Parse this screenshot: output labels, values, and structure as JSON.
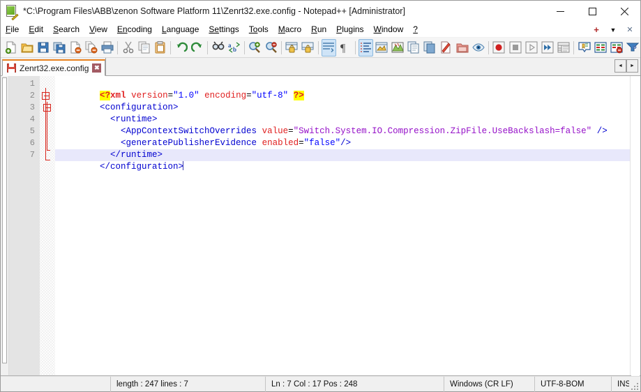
{
  "window": {
    "title": "*C:\\Program Files\\ABB\\zenon Software Platform 11\\Zenrt32.exe.config - Notepad++ [Administrator]",
    "app_icon": "notepad-plus-plus-icon",
    "minimize_label": "Minimize",
    "maximize_label": "Maximize",
    "close_label": "Close"
  },
  "menu": {
    "items": [
      {
        "label": "File",
        "pre": "F",
        "mid": "ile"
      },
      {
        "label": "Edit",
        "pre": "E",
        "mid": "dit"
      },
      {
        "label": "Search",
        "pre": "S",
        "mid": "earch"
      },
      {
        "label": "View",
        "pre": "V",
        "mid": "iew"
      },
      {
        "label": "Encoding",
        "pre": "En",
        "mid": "coding"
      },
      {
        "label": "Language",
        "pre": "L",
        "mid": "anguage"
      },
      {
        "label": "Settings",
        "pre": "Se",
        "mid": "ttings"
      },
      {
        "label": "Tools",
        "pre": "To",
        "mid": "ols"
      },
      {
        "label": "Macro",
        "pre": "M",
        "mid": "acro"
      },
      {
        "label": "Run",
        "pre": "R",
        "mid": "un"
      },
      {
        "label": "Plugins",
        "pre": "P",
        "mid": "lugins"
      },
      {
        "label": "Window",
        "pre": "W",
        "mid": "indow"
      },
      {
        "label": "?",
        "pre": "?",
        "mid": ""
      }
    ],
    "right_icons": [
      {
        "name": "new-tab-plus-icon",
        "glyph": "+",
        "color": "#b02a2a"
      },
      {
        "name": "tab-list-dropdown-icon",
        "glyph": "▼",
        "color": "#1a1a1a"
      },
      {
        "name": "close-document-icon",
        "glyph": "✕",
        "color": "#5a6e88"
      }
    ]
  },
  "toolbar": {
    "overflow_glyph": "»",
    "buttons": [
      {
        "name": "new-file-button",
        "tooltip": "New"
      },
      {
        "name": "open-file-button",
        "tooltip": "Open"
      },
      {
        "name": "save-button",
        "tooltip": "Save"
      },
      {
        "name": "save-all-button",
        "tooltip": "Save All"
      },
      {
        "name": "close-button",
        "tooltip": "Close"
      },
      {
        "name": "close-all-button",
        "tooltip": "Close All"
      },
      {
        "name": "print-button",
        "tooltip": "Print"
      },
      {
        "name": "cut-button",
        "tooltip": "Cut"
      },
      {
        "name": "copy-button",
        "tooltip": "Copy"
      },
      {
        "name": "paste-button",
        "tooltip": "Paste"
      },
      {
        "name": "undo-button",
        "tooltip": "Undo"
      },
      {
        "name": "redo-button",
        "tooltip": "Redo"
      },
      {
        "name": "find-button",
        "tooltip": "Find"
      },
      {
        "name": "replace-button",
        "tooltip": "Replace"
      },
      {
        "name": "zoom-in-button",
        "tooltip": "Zoom In"
      },
      {
        "name": "zoom-out-button",
        "tooltip": "Zoom Out"
      },
      {
        "name": "sync-vertical-scroll-button",
        "tooltip": "Synchronize Vertical Scrolling"
      },
      {
        "name": "sync-horizontal-scroll-button",
        "tooltip": "Synchronize Horizontal Scrolling"
      },
      {
        "name": "word-wrap-button",
        "tooltip": "Word wrap",
        "active": true
      },
      {
        "name": "show-all-characters-button",
        "tooltip": "Show All Characters"
      },
      {
        "name": "show-indent-guide-button",
        "tooltip": "Show Indent Guide",
        "active": true
      },
      {
        "name": "user-defined-dialog-button",
        "tooltip": "User Defined Dialogue"
      },
      {
        "name": "document-map-button",
        "tooltip": "Document Map"
      },
      {
        "name": "function-list-button",
        "tooltip": "Function List"
      },
      {
        "name": "document-list-button",
        "tooltip": "Document List"
      },
      {
        "name": "monitoring-button",
        "tooltip": "Monitoring"
      },
      {
        "name": "folder-as-workspace-button",
        "tooltip": "Folder as Workspace"
      },
      {
        "name": "preview-button",
        "tooltip": "Preview"
      },
      {
        "name": "record-macro-button",
        "tooltip": "Start Recording"
      },
      {
        "name": "stop-macro-button",
        "tooltip": "Stop Recording"
      },
      {
        "name": "play-macro-button",
        "tooltip": "Playback"
      },
      {
        "name": "run-macro-multiple-button",
        "tooltip": "Run a Macro Multiple Times"
      },
      {
        "name": "save-macro-button",
        "tooltip": "Save Current Recorded Macro"
      },
      {
        "name": "bookmark-button",
        "tooltip": "Toggle Bookmark"
      },
      {
        "name": "remove-duplicate-lines-button",
        "tooltip": "Remove Consecutive Duplicate Lines"
      },
      {
        "name": "remove-empty-lines-button",
        "tooltip": "Remove Empty Lines"
      },
      {
        "name": "sort-lines-button",
        "tooltip": "Sort Lines"
      }
    ]
  },
  "tabs": {
    "items": [
      {
        "label": "Zenrt32.exe.config",
        "modified": true,
        "active": true,
        "close_glyph": "✖"
      }
    ],
    "scroll_left_glyph": "◄",
    "scroll_right_glyph": "►"
  },
  "editor": {
    "line_numbers": [
      1,
      2,
      3,
      4,
      5,
      6,
      7
    ],
    "current_line": 7,
    "fold_markers": [
      {
        "line": 2,
        "type": "open-fold-box"
      },
      {
        "line": 3,
        "type": "open-fold-box"
      },
      {
        "line": 6,
        "type": "fold-branch-end"
      },
      {
        "line": 7,
        "type": "fold-tail-end"
      }
    ],
    "lines": [
      {
        "n": 1,
        "tokens": [
          {
            "t": "<?",
            "c": "tk-pi"
          },
          {
            "t": "xml",
            "c": "tk-pin"
          },
          {
            "t": " ",
            "c": "tk-eq"
          },
          {
            "t": "version",
            "c": "tk-attr"
          },
          {
            "t": "=",
            "c": "tk-eq"
          },
          {
            "t": "\"1.0\"",
            "c": "tk-val"
          },
          {
            "t": " ",
            "c": "tk-eq"
          },
          {
            "t": "encoding",
            "c": "tk-attr"
          },
          {
            "t": "=",
            "c": "tk-eq"
          },
          {
            "t": "\"utf-8\"",
            "c": "tk-val"
          },
          {
            "t": " ",
            "c": "tk-eq"
          },
          {
            "t": "?>",
            "c": "tk-pi"
          }
        ]
      },
      {
        "n": 2,
        "tokens": [
          {
            "t": "<configuration>",
            "c": "tk-tag"
          }
        ]
      },
      {
        "n": 3,
        "tokens": [
          {
            "t": "  <runtime>",
            "c": "tk-tag"
          }
        ]
      },
      {
        "n": 4,
        "tokens": [
          {
            "t": "    <AppContextSwitchOverrides ",
            "c": "tk-tag"
          },
          {
            "t": "value",
            "c": "tk-attr"
          },
          {
            "t": "=",
            "c": "tk-eq"
          },
          {
            "t": "\"Switch.System.IO.Compression.ZipFile.UseBackslash=false\"",
            "c": "tk-val2"
          },
          {
            "t": " ",
            "c": "tk-eq"
          },
          {
            "t": "/>",
            "c": "tk-tag"
          }
        ]
      },
      {
        "n": 5,
        "tokens": [
          {
            "t": "    <generatePublisherEvidence ",
            "c": "tk-tag"
          },
          {
            "t": "enabled",
            "c": "tk-attr"
          },
          {
            "t": "=",
            "c": "tk-eq"
          },
          {
            "t": "\"false\"",
            "c": "tk-val"
          },
          {
            "t": "/>",
            "c": "tk-tag"
          }
        ]
      },
      {
        "n": 6,
        "tokens": [
          {
            "t": "  </runtime>",
            "c": "tk-tag"
          }
        ]
      },
      {
        "n": 7,
        "tokens": [
          {
            "t": "</configuration>",
            "c": "tk-tag"
          }
        ],
        "caret": true
      }
    ]
  },
  "statusbar": {
    "language": "",
    "length_lines": "length : 247   lines : 7",
    "caret_info": "Ln : 7   Col : 17   Pos : 248",
    "eol": "Windows (CR LF)",
    "encoding": "UTF-8-BOM",
    "insert_mode": "INS"
  },
  "colors": {
    "titlebar_bg": "#ffffff",
    "toolbar_bg": "#f5f5f5",
    "gutter_bg": "#e4e4e4",
    "current_line_bg": "#e8e8fb",
    "tab_active_top": "#e8821e",
    "tag_blue": "#0000d0",
    "attr_red": "#e02020",
    "value_blue": "#0000ff",
    "value_purple": "#9510c8",
    "pi_highlight": "#ffff00",
    "fold_red": "#d8241b"
  }
}
